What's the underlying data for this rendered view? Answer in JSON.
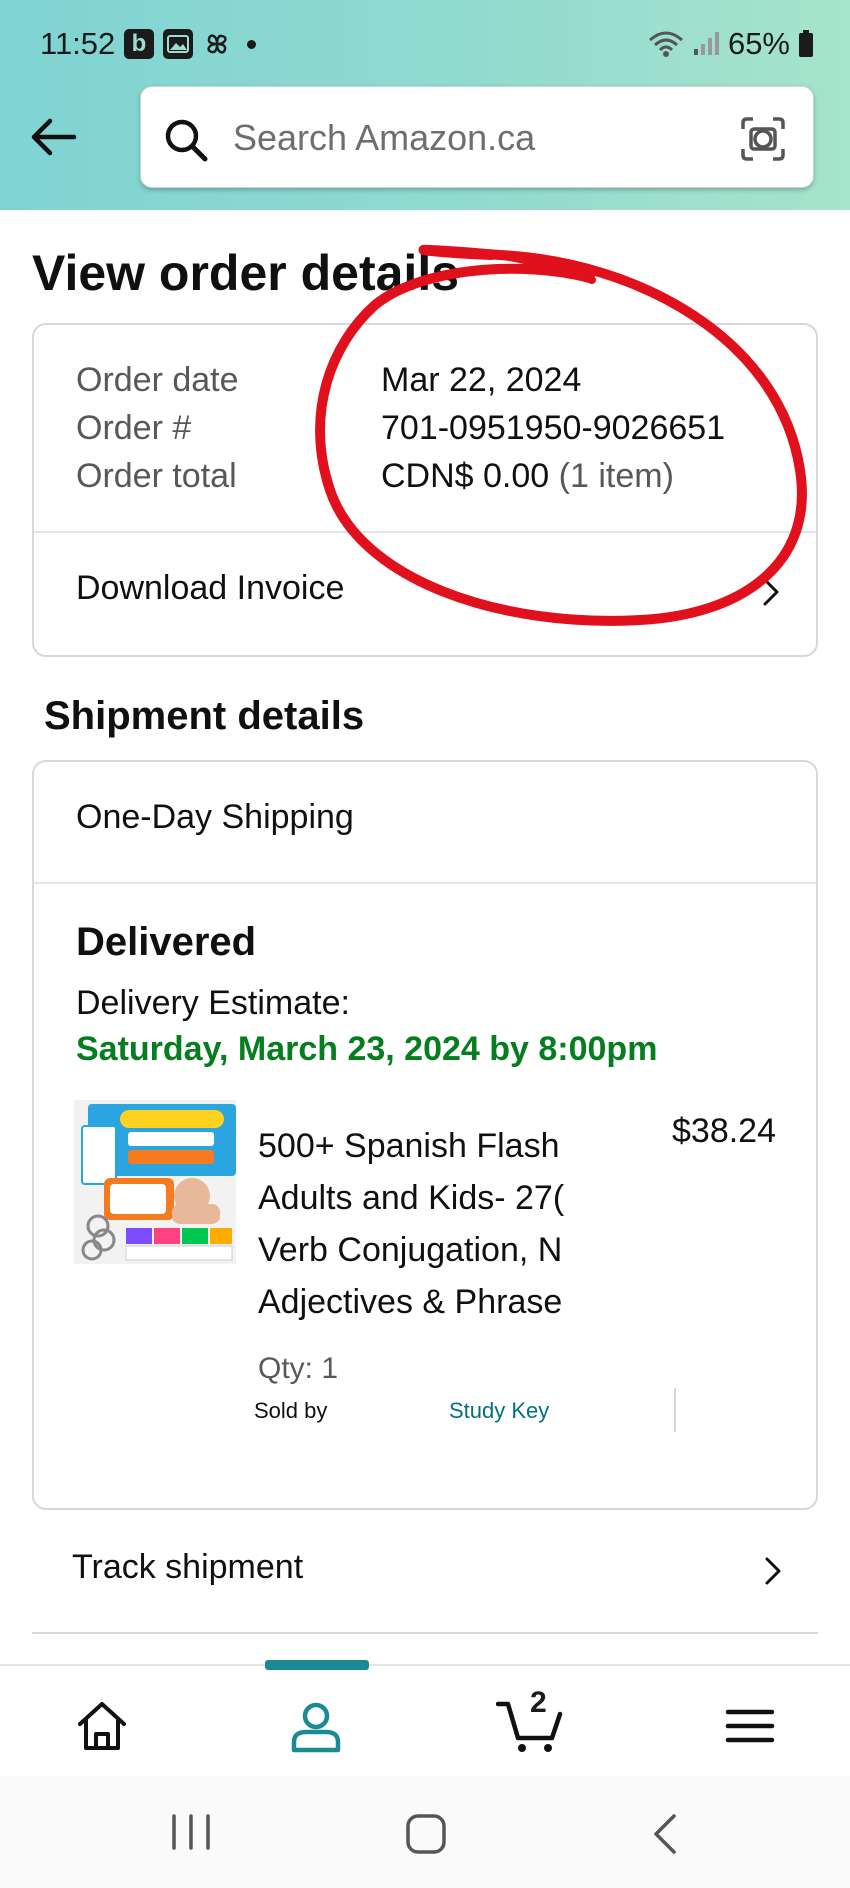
{
  "status_bar": {
    "time": "11:52",
    "left_icons": [
      "b",
      "image-icon",
      "pinwheel-icon"
    ],
    "battery": "65%"
  },
  "search": {
    "placeholder": "Search Amazon.ca"
  },
  "page": {
    "title": "View order details"
  },
  "order": {
    "rows": [
      {
        "label": "Order date",
        "value": "Mar 22, 2024",
        "extra": ""
      },
      {
        "label": "Order #",
        "value": "701-0951950-9026651",
        "extra": ""
      },
      {
        "label": "Order total",
        "value": "CDN$ 0.00",
        "extra": "(1 item)"
      }
    ],
    "download_invoice": "Download Invoice"
  },
  "shipment": {
    "section_title": "Shipment details",
    "shipping_speed": "One-Day Shipping",
    "status": "Delivered",
    "estimate_label": "Delivery Estimate:",
    "estimate_date": "Saturday, March 23, 2024 by 8:00pm",
    "item": {
      "title_lines": [
        "500+ Spanish Flash",
        "Adults and Kids- 27(",
        "Verb Conjugation, N",
        "Adjectives & Phrase"
      ],
      "price": "$38.24",
      "qty": "Qty: 1",
      "sold_by_label": "Sold by",
      "seller": "Study Key"
    },
    "track_label": "Track shipment"
  },
  "bottom_nav": {
    "items": [
      "home-icon",
      "account-icon",
      "cart-icon",
      "menu-icon"
    ],
    "active": "account-icon",
    "cart_count": "2"
  },
  "colors": {
    "header_gradient": [
      "#7fd3d3",
      "#a6e4cb"
    ],
    "delivery_green": "#067d1e",
    "link_teal": "#007185",
    "annotation_red": "#e0101c",
    "nav_active": "#1a8a95"
  }
}
